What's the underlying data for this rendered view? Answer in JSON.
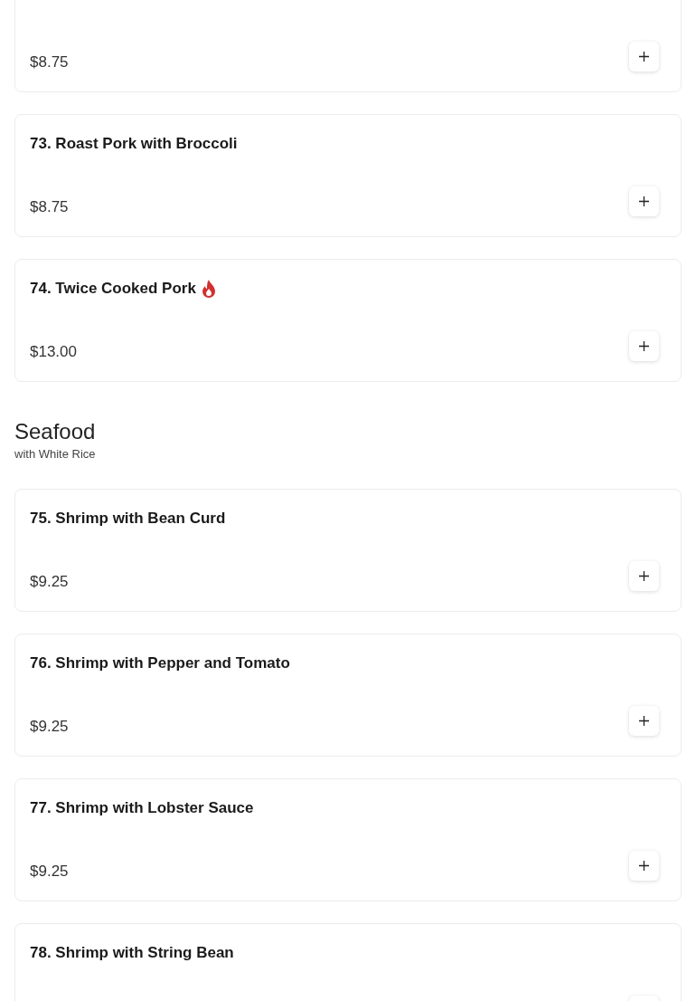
{
  "sections": [
    {
      "items": [
        {
          "price": "$8.75"
        },
        {
          "name": "73. Roast Pork with Broccoli",
          "price": "$8.75",
          "spicy": false
        },
        {
          "name": "74. Twice Cooked Pork",
          "price": "$13.00",
          "spicy": true
        }
      ]
    },
    {
      "title": "Seafood",
      "subtitle": "with White Rice",
      "items": [
        {
          "name": "75. Shrimp with Bean Curd",
          "price": "$9.25",
          "spicy": false
        },
        {
          "name": "76. Shrimp with Pepper and Tomato",
          "price": "$9.25",
          "spicy": false
        },
        {
          "name": "77. Shrimp with Lobster Sauce",
          "price": "$9.25",
          "spicy": false
        },
        {
          "name": "78. Shrimp with String Bean",
          "spicy": false
        }
      ]
    }
  ]
}
